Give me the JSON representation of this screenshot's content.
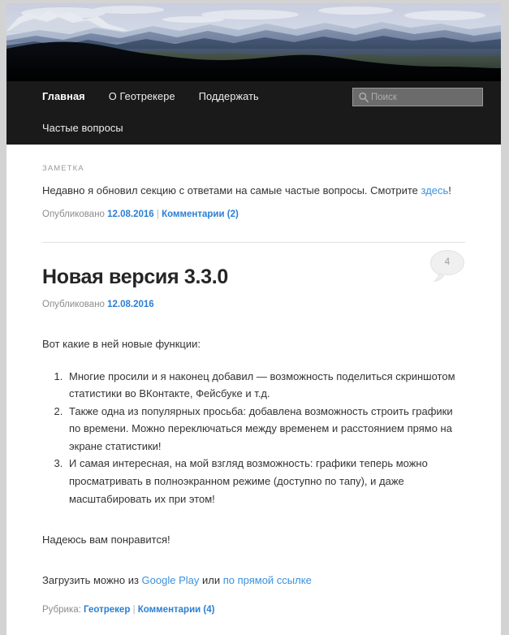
{
  "site": {
    "banner_alt": "mountain-panorama-header"
  },
  "nav": {
    "items": [
      {
        "label": "Главная",
        "active": true
      },
      {
        "label": "О Геотрекере",
        "active": false
      },
      {
        "label": "Поддержать",
        "active": false
      },
      {
        "label": "Частые вопросы",
        "active": false
      }
    ]
  },
  "search": {
    "placeholder": "Поиск",
    "value": "",
    "icon": "search-icon"
  },
  "posts": [
    {
      "format_label": "ЗАМЕТКА",
      "body_before_link": "Недавно я обновил секцию с ответами на самые частые вопросы. Смотрите ",
      "body_link": "здесь",
      "body_after_link": "!",
      "meta_published_label": "Опубликовано",
      "meta_date": "12.08.2016",
      "meta_separator": "|",
      "meta_comments": "Комментарии (2)"
    },
    {
      "title": "Новая версия 3.3.0",
      "comment_count": "4",
      "meta_published_label": "Опубликовано",
      "meta_date": "12.08.2016",
      "intro": "Вот какие в ней новые функции:",
      "features": [
        "Многие просили и я наконец добавил — возможность поделиться скриншотом статистики во ВКонтакте, Фейсбуке и т.д.",
        "Также одна из популярных просьба: добавлена возможность строить графики по времени. Можно переключаться между временем и расстоянием прямо на экране статистики!",
        "И самая интересная, на мой взгляд возможность: графики теперь можно просматривать в полноэкранном режиме (доступно по тапу), и даже масштабировать их при этом!"
      ],
      "outro": "Надеюсь вам понравится!",
      "download_prefix": "Загрузить можно из ",
      "download_link_1": "Google Play",
      "download_middle": " или ",
      "download_link_2": "по прямой ссылке",
      "footer_category_label": "Рубрика:",
      "footer_category": "Геотрекер",
      "footer_separator": "|",
      "footer_comments": "Комментарии (4)"
    }
  ],
  "colors": {
    "link": "#3b91e0",
    "meta_link": "#2a7fd4",
    "nav_bg": "#1a1a1a",
    "page_bg": "#d3d3d3"
  }
}
